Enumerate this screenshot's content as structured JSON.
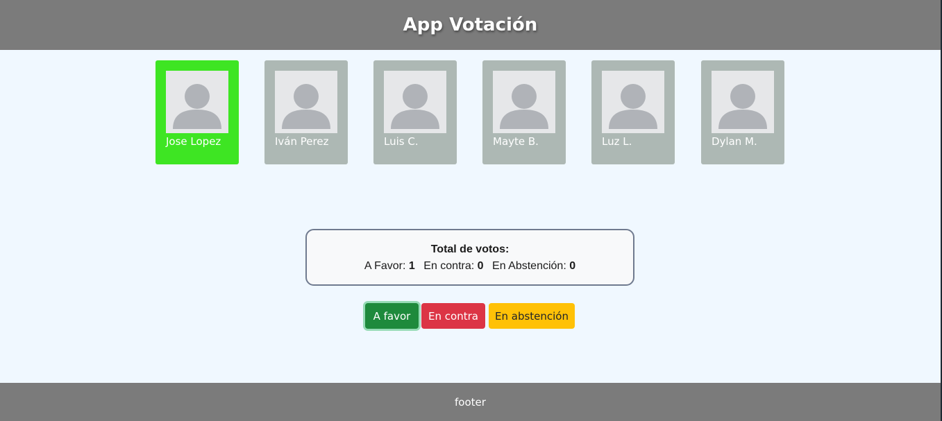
{
  "header": {
    "title": "App Votación"
  },
  "candidates": [
    {
      "name": "Jose Lopez",
      "selected": true
    },
    {
      "name": "Iván Perez",
      "selected": false
    },
    {
      "name": "Luis C.",
      "selected": false
    },
    {
      "name": "Mayte B.",
      "selected": false
    },
    {
      "name": "Luz L.",
      "selected": false
    },
    {
      "name": "Dylan M.",
      "selected": false
    }
  ],
  "totals": {
    "title": "Total de votos:",
    "favor_label": "A Favor:",
    "favor_value": "1",
    "contra_label": "En contra:",
    "contra_value": "0",
    "abstencion_label": "En Abstención:",
    "abstencion_value": "0"
  },
  "buttons": {
    "favor": "A favor",
    "contra": "En contra",
    "abstencion": "En abstención"
  },
  "footer": {
    "text": "footer"
  },
  "colors": {
    "header_bg": "#7b7b7b",
    "selected_card": "#3ee523",
    "card": "#adb8b4",
    "favor": "#1e8a3c",
    "contra": "#dc3545",
    "abstencion": "#ffc107"
  },
  "icons": {
    "avatar": "user-silhouette-icon"
  }
}
